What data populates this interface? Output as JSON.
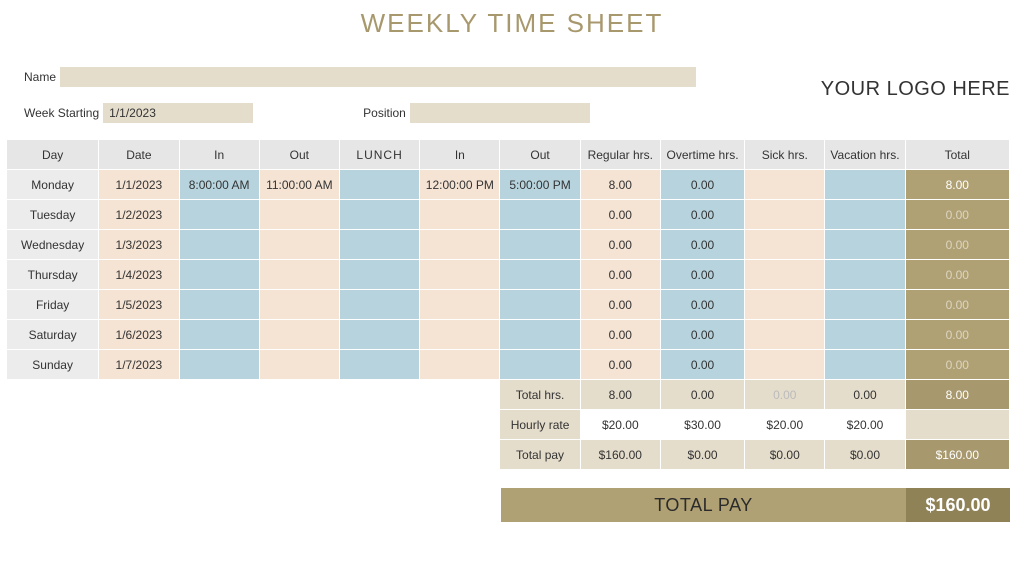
{
  "title": "WEEKLY TIME SHEET",
  "logo_text": "YOUR LOGO HERE",
  "meta": {
    "name_label": "Name",
    "name_value": "",
    "week_label": "Week Starting",
    "week_value": "1/1/2023",
    "position_label": "Position",
    "position_value": ""
  },
  "headers": {
    "day": "Day",
    "date": "Date",
    "in1": "In",
    "out1": "Out",
    "lunch": "LUNCH",
    "in2": "In",
    "out2": "Out",
    "reg": "Regular hrs.",
    "ot": "Overtime hrs.",
    "sick": "Sick hrs.",
    "vac": "Vacation hrs.",
    "total": "Total"
  },
  "rows": [
    {
      "day": "Monday",
      "date": "1/1/2023",
      "in1": "8:00:00 AM",
      "out1": "11:00:00 AM",
      "in2": "12:00:00 PM",
      "out2": "5:00:00 PM",
      "reg": "8.00",
      "ot": "0.00",
      "sick": "",
      "vac": "",
      "total": "8.00"
    },
    {
      "day": "Tuesday",
      "date": "1/2/2023",
      "in1": "",
      "out1": "",
      "in2": "",
      "out2": "",
      "reg": "0.00",
      "ot": "0.00",
      "sick": "",
      "vac": "",
      "total": "0.00"
    },
    {
      "day": "Wednesday",
      "date": "1/3/2023",
      "in1": "",
      "out1": "",
      "in2": "",
      "out2": "",
      "reg": "0.00",
      "ot": "0.00",
      "sick": "",
      "vac": "",
      "total": "0.00"
    },
    {
      "day": "Thursday",
      "date": "1/4/2023",
      "in1": "",
      "out1": "",
      "in2": "",
      "out2": "",
      "reg": "0.00",
      "ot": "0.00",
      "sick": "",
      "vac": "",
      "total": "0.00"
    },
    {
      "day": "Friday",
      "date": "1/5/2023",
      "in1": "",
      "out1": "",
      "in2": "",
      "out2": "",
      "reg": "0.00",
      "ot": "0.00",
      "sick": "",
      "vac": "",
      "total": "0.00"
    },
    {
      "day": "Saturday",
      "date": "1/6/2023",
      "in1": "",
      "out1": "",
      "in2": "",
      "out2": "",
      "reg": "0.00",
      "ot": "0.00",
      "sick": "",
      "vac": "",
      "total": "0.00"
    },
    {
      "day": "Sunday",
      "date": "1/7/2023",
      "in1": "",
      "out1": "",
      "in2": "",
      "out2": "",
      "reg": "0.00",
      "ot": "0.00",
      "sick": "",
      "vac": "",
      "total": "0.00"
    }
  ],
  "summary": {
    "total_hrs_label": "Total hrs.",
    "hourly_rate_label": "Hourly rate",
    "total_pay_label": "Total pay",
    "total_hrs": {
      "reg": "8.00",
      "ot": "0.00",
      "sick": "0.00",
      "vac": "0.00",
      "total": "8.00"
    },
    "hourly_rate": {
      "reg": "$20.00",
      "ot": "$30.00",
      "sick": "$20.00",
      "vac": "$20.00",
      "total": ""
    },
    "total_pay": {
      "reg": "$160.00",
      "ot": "$0.00",
      "sick": "$0.00",
      "vac": "$0.00",
      "total": "$160.00"
    }
  },
  "grand": {
    "label": "TOTAL PAY",
    "value": "$160.00"
  }
}
